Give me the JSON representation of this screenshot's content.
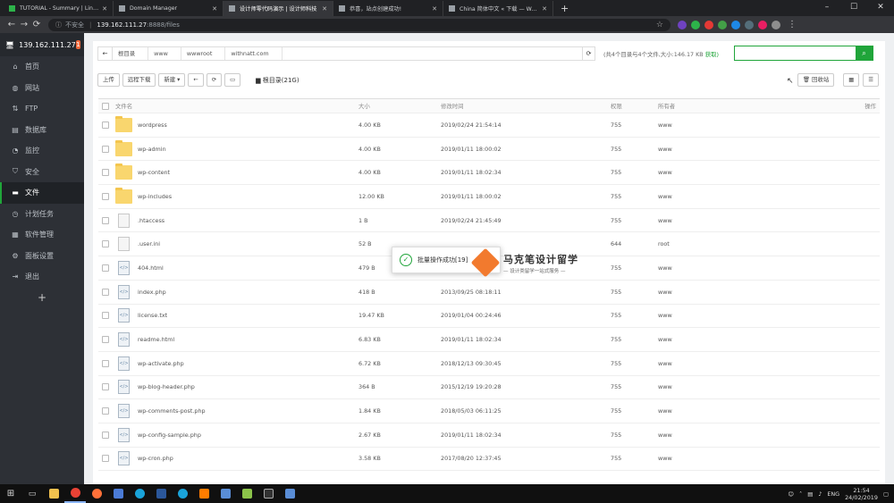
{
  "browser": {
    "tabs": [
      {
        "title": "TUTORIAL - Summary | Linode M",
        "color": "#2db34a",
        "active": false
      },
      {
        "title": "Domain Manager",
        "color": "#9aa0a6",
        "active": false
      },
      {
        "title": "设计师零代码演示 | 设计师科技",
        "color": "#9aa0a6",
        "active": true
      },
      {
        "title": "恭喜，站点创建成功!",
        "color": "#9aa0a6",
        "active": false
      },
      {
        "title": "China 简体中文 « 下载 — WordP",
        "color": "#9aa0a6",
        "active": false
      }
    ],
    "new_tab": "+",
    "security": "不安全",
    "url_host": "139.162.111.27",
    "url_path": ":8888/files"
  },
  "sidebar": {
    "server_ip": "139.162.111.27",
    "badge": "1",
    "items": [
      {
        "label": "首页",
        "icon": "home-icon",
        "active": false
      },
      {
        "label": "网站",
        "icon": "globe-icon",
        "active": false
      },
      {
        "label": "FTP",
        "icon": "ftp-icon",
        "active": false
      },
      {
        "label": "数据库",
        "icon": "database-icon",
        "active": false
      },
      {
        "label": "监控",
        "icon": "monitor-icon",
        "active": false
      },
      {
        "label": "安全",
        "icon": "shield-icon",
        "active": false
      },
      {
        "label": "文件",
        "icon": "folder-icon",
        "active": true
      },
      {
        "label": "计划任务",
        "icon": "clock-icon",
        "active": false
      },
      {
        "label": "软件管理",
        "icon": "apps-icon",
        "active": false
      },
      {
        "label": "面板设置",
        "icon": "gear-icon",
        "active": false
      },
      {
        "label": "退出",
        "icon": "logout-icon",
        "active": false
      }
    ],
    "add": "+"
  },
  "files": {
    "breadcrumb": [
      "根目录",
      "www",
      "wwwroot",
      "withnatt.com"
    ],
    "summary": "(共4个目录与4个文件,大小:146.17 KB",
    "summary_link": "获取)",
    "toolbar": {
      "upload": "上传",
      "remote_download": "远程下载",
      "new": "新建",
      "dir_size": "根目录(21G)"
    },
    "recycle": "回收站",
    "columns": {
      "name": "文件名",
      "size": "大小",
      "modified": "修改时间",
      "perm": "权限",
      "owner": "所有者",
      "op": "操作"
    },
    "rows": [
      {
        "name": "wordpress",
        "size": "4.00 KB",
        "modified": "2019/02/24 21:54:14",
        "perm": "755",
        "owner": "www",
        "type": "folder"
      },
      {
        "name": "wp-admin",
        "size": "4.00 KB",
        "modified": "2019/01/11 18:00:02",
        "perm": "755",
        "owner": "www",
        "type": "folder"
      },
      {
        "name": "wp-content",
        "size": "4.00 KB",
        "modified": "2019/01/11 18:02:34",
        "perm": "755",
        "owner": "www",
        "type": "folder"
      },
      {
        "name": "wp-includes",
        "size": "12.00 KB",
        "modified": "2019/01/11 18:00:02",
        "perm": "755",
        "owner": "www",
        "type": "folder"
      },
      {
        "name": ".htaccess",
        "size": "1 B",
        "modified": "2019/02/24 21:45:49",
        "perm": "755",
        "owner": "www",
        "type": "file"
      },
      {
        "name": ".user.ini",
        "size": "52 B",
        "modified": "",
        "perm": "644",
        "owner": "root",
        "type": "file"
      },
      {
        "name": "404.html",
        "size": "479 B",
        "modified": "",
        "perm": "755",
        "owner": "www",
        "type": "code"
      },
      {
        "name": "index.php",
        "size": "418 B",
        "modified": "2013/09/25 08:18:11",
        "perm": "755",
        "owner": "www",
        "type": "code"
      },
      {
        "name": "license.txt",
        "size": "19.47 KB",
        "modified": "2019/01/04 00:24:46",
        "perm": "755",
        "owner": "www",
        "type": "code"
      },
      {
        "name": "readme.html",
        "size": "6.83 KB",
        "modified": "2019/01/11 18:02:34",
        "perm": "755",
        "owner": "www",
        "type": "code"
      },
      {
        "name": "wp-activate.php",
        "size": "6.72 KB",
        "modified": "2018/12/13 09:30:45",
        "perm": "755",
        "owner": "www",
        "type": "code"
      },
      {
        "name": "wp-blog-header.php",
        "size": "364 B",
        "modified": "2015/12/19 19:20:28",
        "perm": "755",
        "owner": "www",
        "type": "code"
      },
      {
        "name": "wp-comments-post.php",
        "size": "1.84 KB",
        "modified": "2018/05/03 06:11:25",
        "perm": "755",
        "owner": "www",
        "type": "code"
      },
      {
        "name": "wp-config-sample.php",
        "size": "2.67 KB",
        "modified": "2019/01/11 18:02:34",
        "perm": "755",
        "owner": "www",
        "type": "code"
      },
      {
        "name": "wp-cron.php",
        "size": "3.58 KB",
        "modified": "2017/08/20 12:37:45",
        "perm": "755",
        "owner": "www",
        "type": "code"
      }
    ]
  },
  "toast": {
    "text": "批量操作成功[19]"
  },
  "watermark": {
    "title": "马克笔设计留学",
    "subtitle": "— 设计类留学一站式服务 —"
  },
  "taskbar": {
    "lang": "ENG",
    "time": "21:54",
    "date": "24/02/2019"
  },
  "colors": {
    "accent": "#20a53a",
    "sidebar": "#2d3036",
    "badge": "#f0693c"
  }
}
